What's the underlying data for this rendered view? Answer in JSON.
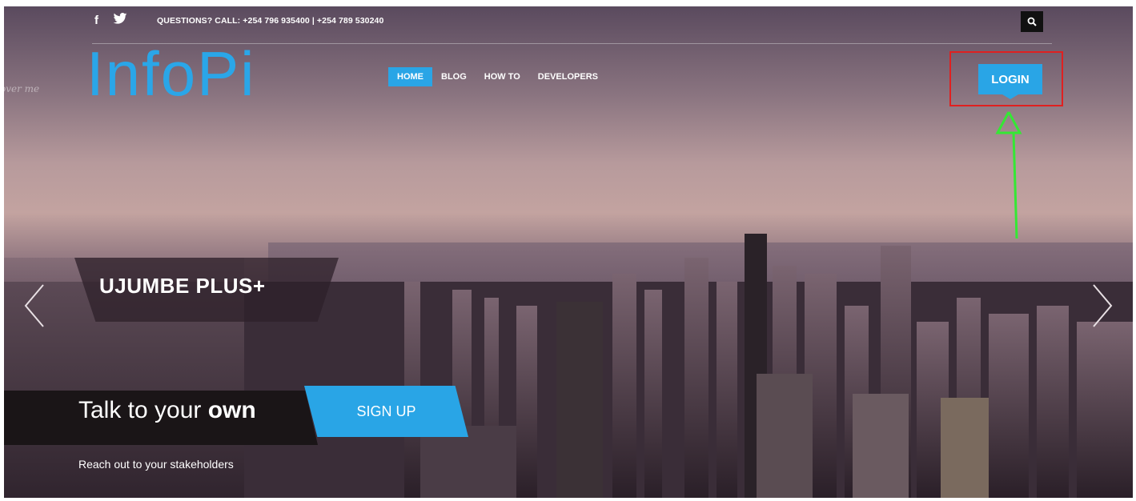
{
  "topbar": {
    "contact_text": "QUESTIONS? CALL: +254 796 935400 | +254 789 530240",
    "social": [
      {
        "name": "facebook",
        "icon": "f"
      },
      {
        "name": "twitter",
        "icon": "twitter"
      }
    ],
    "search_icon": "search-icon"
  },
  "logo": {
    "text": "InfoPi",
    "side_text": "over me"
  },
  "nav": {
    "items": [
      {
        "label": "HOME",
        "active": true
      },
      {
        "label": "BLOG",
        "active": false
      },
      {
        "label": "HOW TO",
        "active": false
      },
      {
        "label": "DEVELOPERS",
        "active": false
      }
    ]
  },
  "login": {
    "label": "LOGIN",
    "highlight_color": "#e02020",
    "arrow_color": "#34e834"
  },
  "slider": {
    "title": "UJUMBE PLUS+",
    "tagline_prefix": "Talk to your ",
    "tagline_bold": "own",
    "signup_label": "SIGN UP",
    "subtext": "Reach out to your stakeholders"
  },
  "colors": {
    "accent": "#29a5e6"
  }
}
